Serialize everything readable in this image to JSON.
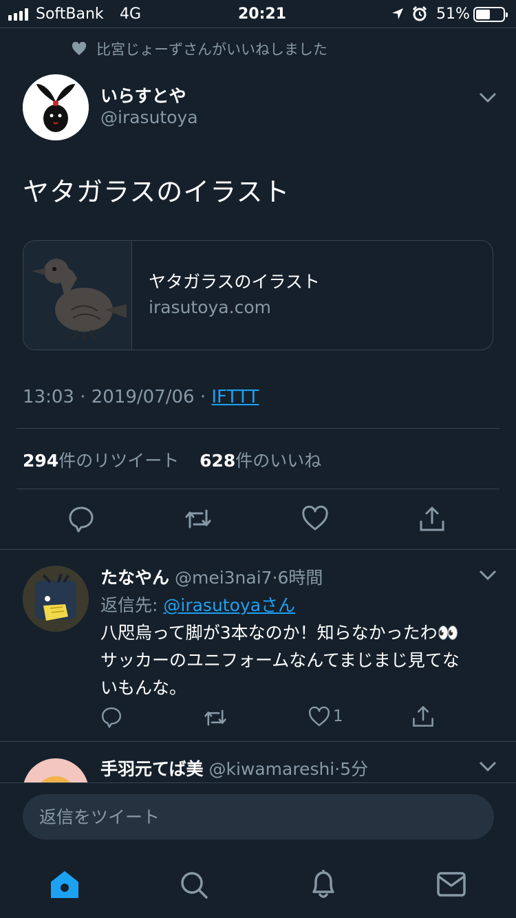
{
  "status_bar": {
    "carrier": "SoftBank",
    "network": "4G",
    "time": "20:21",
    "battery": "51%",
    "icons": [
      "location-icon",
      "alarm-icon",
      "battery-icon"
    ]
  },
  "social_context": {
    "icon": "heart-icon",
    "text": "比宮じょーずさんがいいねしました"
  },
  "tweet": {
    "author": {
      "display_name": "いらすとや",
      "handle": "@irasutoya"
    },
    "text": "ヤタガラスのイラスト",
    "card": {
      "title": "ヤタガラスのイラスト",
      "domain": "irasutoya.com"
    },
    "time": "13:03",
    "separator": "·",
    "date": "2019/07/06",
    "source": "IFTTT",
    "retweet_count": "294",
    "retweet_label": "件のリツイート",
    "like_count": "628",
    "like_label": "件のいいね",
    "actions": [
      "reply-icon",
      "retweet-icon",
      "like-icon",
      "share-icon"
    ]
  },
  "replies": [
    {
      "display_name": "たなやん",
      "handle": "@mei3nai7",
      "time": "6時間",
      "reply_to_label": "返信先:",
      "reply_to": "@irasutoyaさん",
      "text_line1": "八咫烏って脚が3本なのか！知らなかったわ👀",
      "text_line2": "サッカーのユニフォームなんてまじまじ見てな",
      "text_line3": "いもんな。",
      "like_count": "1"
    },
    {
      "display_name": "手羽元てば美",
      "handle": "@kiwamareshi",
      "time": "5分"
    }
  ],
  "compose": {
    "placeholder": "返信をツイート"
  },
  "tabbar": {
    "items": [
      "home-icon",
      "search-icon",
      "notifications-icon",
      "messages-icon"
    ],
    "active_color": "#1da1f2"
  },
  "colors": {
    "background": "#15202b",
    "secondary_text": "#8899a6",
    "accent": "#1da1f2",
    "divider": "#38444d"
  }
}
